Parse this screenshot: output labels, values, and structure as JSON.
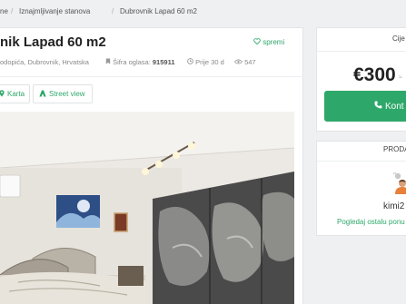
{
  "breadcrumb": {
    "items": [
      "ne",
      "Iznajmljivanje stanova",
      "Dubrovnik Lapad 60 m2"
    ],
    "separator": "/"
  },
  "listing": {
    "title": "nik Lapad 60 m2",
    "save_label": "spremi",
    "location": "odopića, Dubrovnik, Hrvatska",
    "ad_code_label": "Šifra oglasa:",
    "ad_code": "915911",
    "posted": "Prije 30 d",
    "views": "547",
    "tabs": [
      {
        "label": "Karta",
        "icon": "map-marker-icon"
      },
      {
        "label": "Street view",
        "icon": "street-view-icon"
      }
    ]
  },
  "price_panel": {
    "label": "Cije",
    "price": "€300",
    "price_suffix": "≈",
    "contact_label": "Kont"
  },
  "seller_panel": {
    "label": "PRODA",
    "name": "kimi2",
    "link": "Pogledaj ostalu ponu"
  },
  "colors": {
    "accent": "#2ea86a",
    "background": "#eef0f2"
  }
}
